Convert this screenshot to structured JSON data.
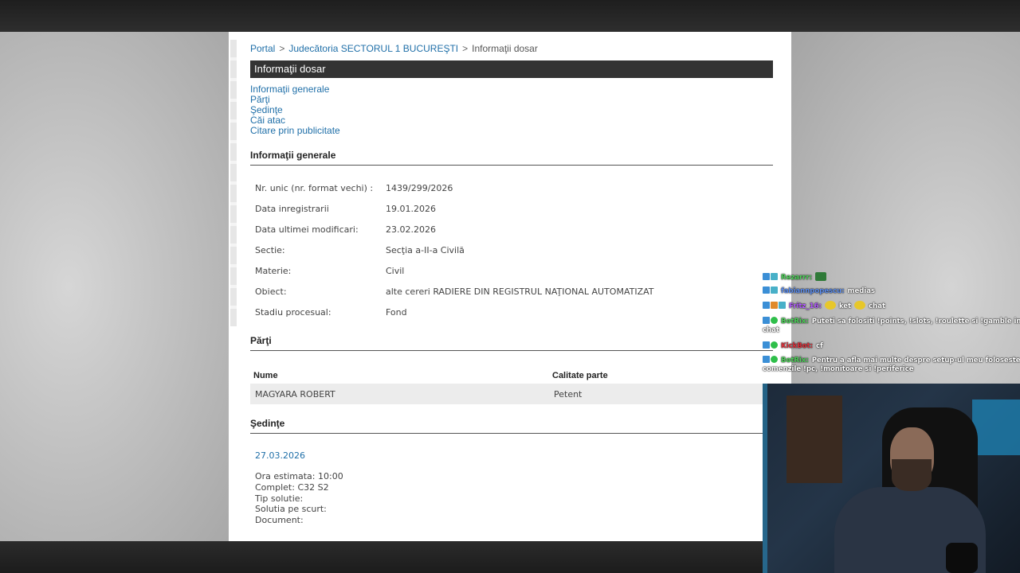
{
  "breadcrumb": {
    "items": [
      "Portal",
      "Judecătoria SECTORUL 1 BUCUREŞTI",
      "Informaţii dosar"
    ],
    "separator": ">"
  },
  "title": "Informaţii dosar",
  "nav": [
    "Informaţii generale",
    "Părţi",
    "Şedinţe",
    "Căi atac",
    "Citare prin publicitate"
  ],
  "general": {
    "heading": "Informaţii generale",
    "rows": [
      {
        "label": "Nr. unic (nr. format vechi) :",
        "value": "1439/299/2026"
      },
      {
        "label": "Data inregistrarii",
        "value": "19.01.2026"
      },
      {
        "label": "Data ultimei modificari:",
        "value": "23.02.2026"
      },
      {
        "label": "Sectie:",
        "value": "Secţia a-II-a Civilă"
      },
      {
        "label": "Materie:",
        "value": "Civil"
      },
      {
        "label": "Obiect:",
        "value": "alte cereri RADIERE DIN REGISTRUL NAŢIONAL AUTOMATIZAT"
      },
      {
        "label": "Stadiu procesual:",
        "value": "Fond"
      }
    ]
  },
  "parti": {
    "heading": "Părţi",
    "columns": [
      "Nume",
      "Calitate parte"
    ],
    "rows": [
      {
        "nume": "MAGYARA ROBERT",
        "calitate": "Petent"
      }
    ]
  },
  "sedinte": {
    "heading": "Şedinţe",
    "date": "27.03.2026",
    "lines": [
      "Ora estimata: 10:00",
      "Complet: C32 S2",
      "Tip solutie:",
      "Solutia pe scurt:",
      "Document:"
    ]
  },
  "chat": {
    "messages": [
      {
        "user": "Rezarrr:",
        "user_color": "#4ed35a",
        "text": "",
        "badges": [
          "mod",
          "sub"
        ],
        "emotes": [
          "green"
        ]
      },
      {
        "user": "fabiannpopescu:",
        "user_color": "#5d8ff0",
        "text": "medias",
        "badges": [
          "mod",
          "sub"
        ],
        "emotes": []
      },
      {
        "user": "Fritz_16:",
        "user_color": "#b35cff",
        "text": "ket",
        "text2": "chat",
        "badges": [
          "mod",
          "vip",
          "sub"
        ],
        "emotes": [
          "yellow",
          "yellow"
        ]
      },
      {
        "user": "BotRix:",
        "user_color": "#4ed35a",
        "text": "Puteti sa folositi !points, !slots, !roulette si !gamble in chat",
        "badges": [
          "mod",
          "bot"
        ],
        "emotes": []
      },
      {
        "user": "KickBot:",
        "user_color": "#e0323c",
        "text": "cf",
        "badges": [
          "mod",
          "bot"
        ],
        "emotes": []
      },
      {
        "user": "BotRix:",
        "user_color": "#4ed35a",
        "text": "Pentru a afla mai multe despre setup-ul meu foloseste comenzile !pc, !monitoare si !periferice",
        "badges": [
          "mod",
          "bot"
        ],
        "emotes": []
      }
    ]
  },
  "colors": {
    "link": "#1f6fa8",
    "title_bar": "#333333",
    "row_highlight": "#ececec"
  }
}
